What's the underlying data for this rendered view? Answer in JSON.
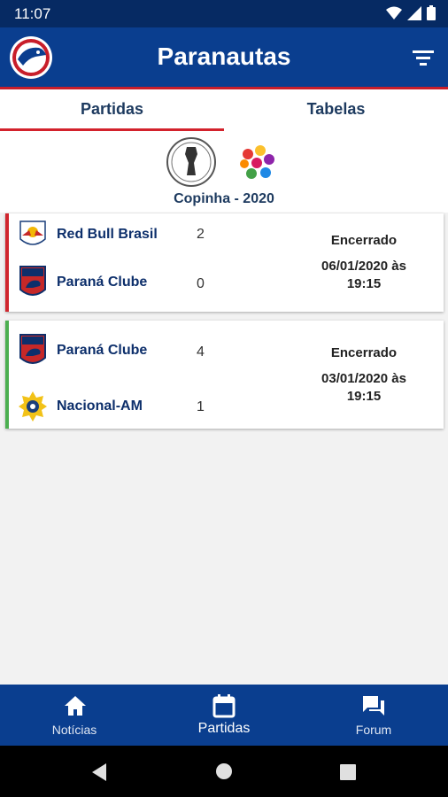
{
  "status_bar": {
    "time": "11:07"
  },
  "app_bar": {
    "title": "Paranautas",
    "logo_icon": "paranautas-logo-icon",
    "filter_icon": "filter-icon"
  },
  "tabs": [
    {
      "label": "Partidas",
      "active": true
    },
    {
      "label": "Tabelas",
      "active": false
    }
  ],
  "competition": {
    "name": "Copinha - 2020"
  },
  "matches": [
    {
      "accent_color": "#d0262e",
      "home": {
        "name": "Red Bull Brasil",
        "score": "2"
      },
      "away": {
        "name": "Paraná Clube",
        "score": "0"
      },
      "status": "Encerrado",
      "date_line1": "06/01/2020 às",
      "date_line2": "19:15"
    },
    {
      "accent_color": "#4caf50",
      "home": {
        "name": "Paraná Clube",
        "score": "4"
      },
      "away": {
        "name": "Nacional-AM",
        "score": "1"
      },
      "status": "Encerrado",
      "date_line1": "03/01/2020 às",
      "date_line2": "19:15"
    }
  ],
  "bottom_nav": [
    {
      "label": "Notícias",
      "icon": "home-icon"
    },
    {
      "label": "Partidas",
      "icon": "calendar-icon"
    },
    {
      "label": "Forum",
      "icon": "forum-icon"
    }
  ],
  "colors": {
    "primary": "#0a3e8f",
    "status_bar": "#062a63",
    "accent_red": "#d3222c"
  }
}
